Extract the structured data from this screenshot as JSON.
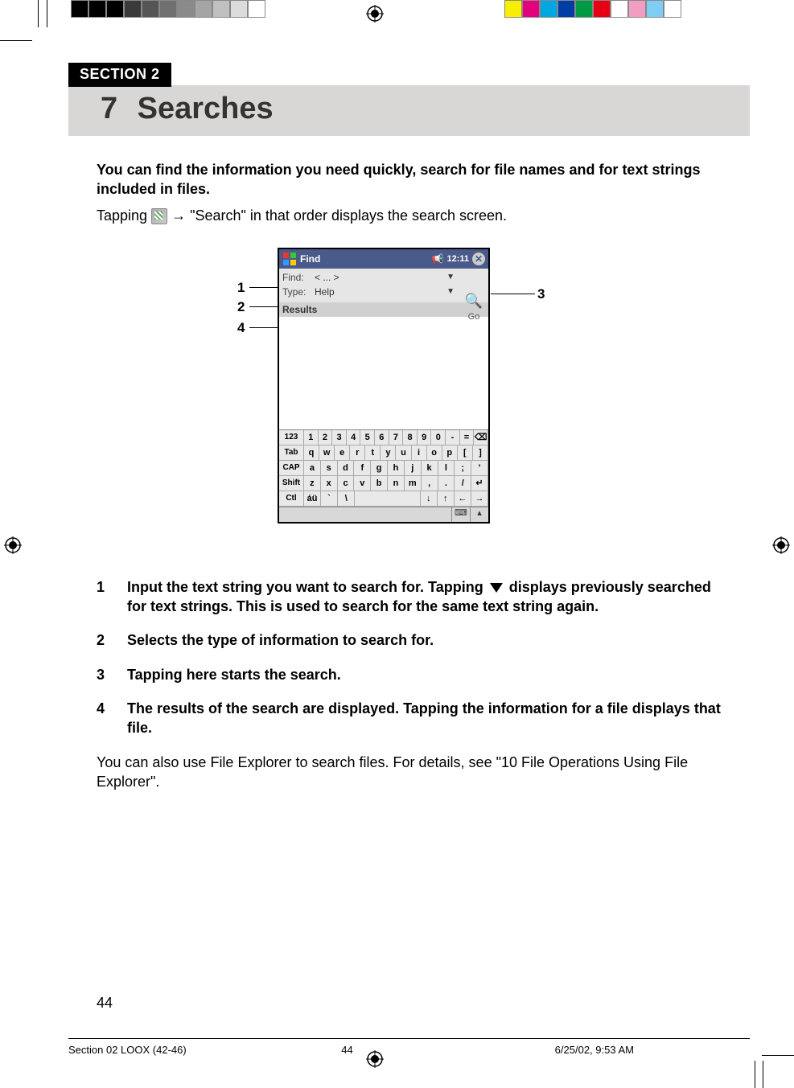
{
  "section_tag": "SECTION 2",
  "chapter_number": "7",
  "chapter_title": "Searches",
  "intro_bold": "You can find the information you need quickly, search for file names and for text strings included in files.",
  "intro_line_pre": "Tapping ",
  "intro_line_post": " → \"Search\" in that order displays the search screen.",
  "callouts": {
    "c1": "1",
    "c2": "2",
    "c3": "3",
    "c4": "4"
  },
  "pda": {
    "title": "Find",
    "time": "12:11",
    "find_label": "Find:",
    "find_value": "< ... >",
    "type_label": "Type:",
    "type_value": "Help",
    "go_label": "Go",
    "results_label": "Results",
    "kb": {
      "r1_lab": "123",
      "r1": [
        "1",
        "2",
        "3",
        "4",
        "5",
        "6",
        "7",
        "8",
        "9",
        "0",
        "-",
        "=",
        "⌫"
      ],
      "r2_lab": "Tab",
      "r2": [
        "q",
        "w",
        "e",
        "r",
        "t",
        "y",
        "u",
        "i",
        "o",
        "p",
        "[",
        "]"
      ],
      "r3_lab": "CAP",
      "r3": [
        "a",
        "s",
        "d",
        "f",
        "g",
        "h",
        "j",
        "k",
        "l",
        ";",
        "'"
      ],
      "r4_lab": "Shift",
      "r4": [
        "z",
        "x",
        "c",
        "v",
        "b",
        "n",
        "m",
        ",",
        ".",
        "/",
        "↵"
      ],
      "r5_lab": "Ctl",
      "r5": [
        "áü",
        "`",
        "\\",
        " ",
        "↓",
        "↑",
        "←",
        "→"
      ]
    }
  },
  "list": {
    "i1_pre": "Input the text string you want to search for. Tapping ",
    "i1_post": " displays previously searched for text strings. This is used to search for the same text string again.",
    "i2": "Selects the type of information to search for.",
    "i3": "Tapping here starts the search.",
    "i4": "The results of the search are displayed.  Tapping the information for a file displays that file."
  },
  "closing": "You can also use File Explorer to search files. For details, see \"10 File Operations Using File Explorer\".",
  "page_number": "44",
  "footer": {
    "left": "Section 02 LOOX (42-46)",
    "center": "44",
    "right": "6/25/02, 9:53 AM"
  },
  "printer_colors_left": [
    "#000000",
    "#000000",
    "#000000",
    "#3a3a3a",
    "#555555",
    "#707070",
    "#8a8a8a",
    "#a5a5a5",
    "#c0c0c0",
    "#dcdcdc",
    "#ffffff"
  ],
  "printer_colors_right": [
    "#f7ef00",
    "#e5007e",
    "#00a7e1",
    "#003da5",
    "#009944",
    "#e60012",
    "#ffffff",
    "#f19ec2",
    "#7ecef4",
    "#ffffff"
  ]
}
